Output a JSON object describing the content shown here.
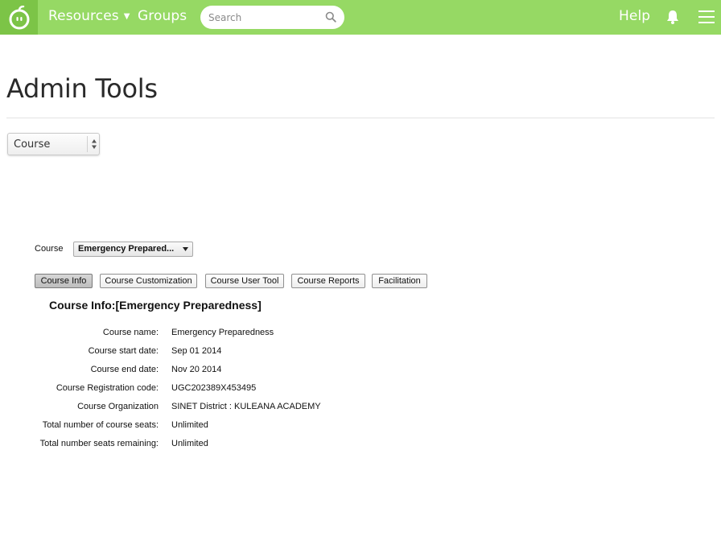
{
  "nav": {
    "resources": "Resources",
    "groups": "Groups",
    "search_placeholder": "Search",
    "help": "Help"
  },
  "icons": {
    "logo": "apple-logo-icon",
    "resources_caret": "chevron-down-icon",
    "search": "search-icon",
    "notifications": "bell-icon",
    "menu": "hamburger-menu-icon",
    "select_arrows": "up-down-arrows-icon",
    "dropdown_arrow": "triangle-down-icon"
  },
  "colors": {
    "nav_bg": "#96d964",
    "logo_bg": "#7cc447"
  },
  "page": {
    "title": "Admin Tools",
    "type_select_value": "Course"
  },
  "admin": {
    "course_label": "Course",
    "course_selected": "Emergency Prepared...",
    "tabs": [
      "Course Info",
      "Course Customization",
      "Course User Tool",
      "Course Reports",
      "Facilitation"
    ],
    "active_tab": "Course Info",
    "info_title": "Course Info:[Emergency Preparedness]",
    "fields": [
      {
        "key": "Course name:",
        "value": "Emergency Preparedness"
      },
      {
        "key": "Course start date:",
        "value": "Sep 01 2014"
      },
      {
        "key": "Course end date:",
        "value": "Nov 20 2014"
      },
      {
        "key": "Course Registration code:",
        "value": "UGC202389X453495"
      },
      {
        "key": "Course Organization",
        "value": "SINET District : KULEANA ACADEMY"
      },
      {
        "key": "Total number of course seats:",
        "value": "Unlimited"
      },
      {
        "key": "Total number seats remaining:",
        "value": "Unlimited"
      }
    ]
  }
}
